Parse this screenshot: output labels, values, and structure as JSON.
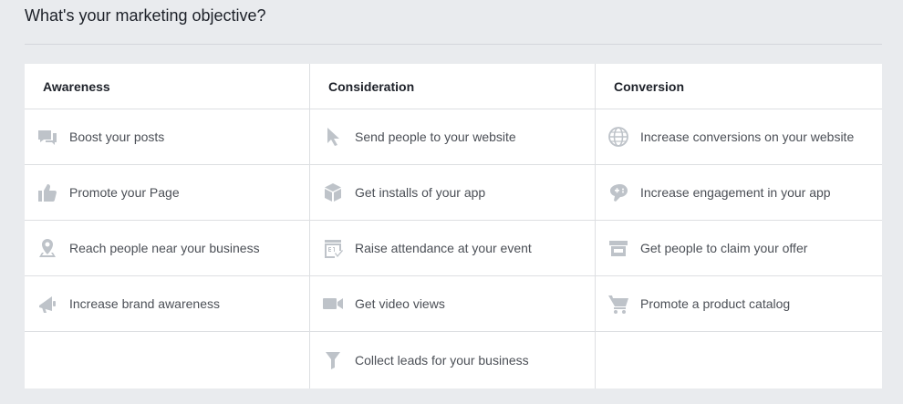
{
  "page": {
    "title": "What's your marketing objective?"
  },
  "colors": {
    "background": "#e9ebee",
    "panel": "#ffffff",
    "icon": "#bec3c9",
    "text": "#4b4f56",
    "header_text": "#1d2129",
    "border": "#dddfe2"
  },
  "columns": [
    {
      "header": "Awareness",
      "items": [
        {
          "label": "Boost your posts",
          "icon": "speech-bubbles-icon"
        },
        {
          "label": "Promote your Page",
          "icon": "thumbs-up-icon"
        },
        {
          "label": "Reach people near your business",
          "icon": "location-pin-icon"
        },
        {
          "label": "Increase brand awareness",
          "icon": "megaphone-icon"
        }
      ]
    },
    {
      "header": "Consideration",
      "items": [
        {
          "label": "Send people to your website",
          "icon": "cursor-icon"
        },
        {
          "label": "Get installs of your app",
          "icon": "box-icon"
        },
        {
          "label": "Raise attendance at your event",
          "icon": "calendar-icon"
        },
        {
          "label": "Get video views",
          "icon": "video-camera-icon"
        },
        {
          "label": "Collect leads for your business",
          "icon": "funnel-icon"
        }
      ]
    },
    {
      "header": "Conversion",
      "items": [
        {
          "label": "Increase conversions on your website",
          "icon": "globe-icon"
        },
        {
          "label": "Increase engagement in your app",
          "icon": "game-controller-icon"
        },
        {
          "label": "Get people to claim your offer",
          "icon": "storefront-icon"
        },
        {
          "label": "Promote a product catalog",
          "icon": "shopping-cart-icon"
        }
      ]
    }
  ]
}
